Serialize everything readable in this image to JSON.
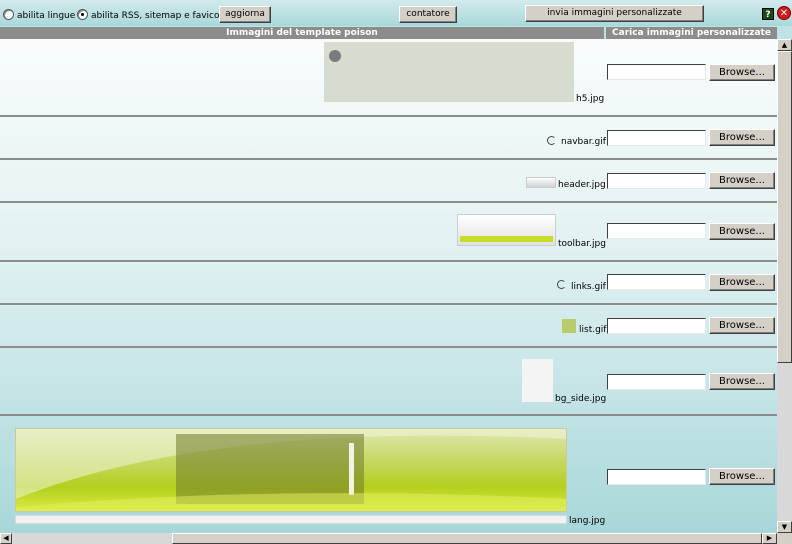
{
  "toolbar": {
    "radio_languages_label": "abilita lingue",
    "radio_rss_label": "abilita RSS, sitemap e favicon",
    "update_button": "aggiorna",
    "counter_button": "contatore",
    "send_images_button": "invia immagini personalizzate",
    "help_icon": "?",
    "close_icon": "✕"
  },
  "headers": {
    "template_images": "Immagini del template poison",
    "upload_images": "Carica immagini personalizzate"
  },
  "rows": [
    {
      "filename": "h5.jpg",
      "browse_label": "Browse...",
      "value": ""
    },
    {
      "filename": "navbar.gif",
      "browse_label": "Browse...",
      "value": ""
    },
    {
      "filename": "header.jpg",
      "browse_label": "Browse...",
      "value": ""
    },
    {
      "filename": "toolbar.jpg",
      "browse_label": "Browse...",
      "value": ""
    },
    {
      "filename": "links.gif",
      "browse_label": "Browse...",
      "value": ""
    },
    {
      "filename": "list.gif",
      "browse_label": "Browse...",
      "value": ""
    },
    {
      "filename": "bg_side.jpg",
      "browse_label": "Browse...",
      "value": ""
    },
    {
      "filename": "lang.jpg",
      "browse_label": "Browse...",
      "value": ""
    }
  ],
  "colors": {
    "header_bg": "#8c8c8c",
    "accent_green": "#c8dc2a",
    "close_red": "#d31a1a"
  }
}
